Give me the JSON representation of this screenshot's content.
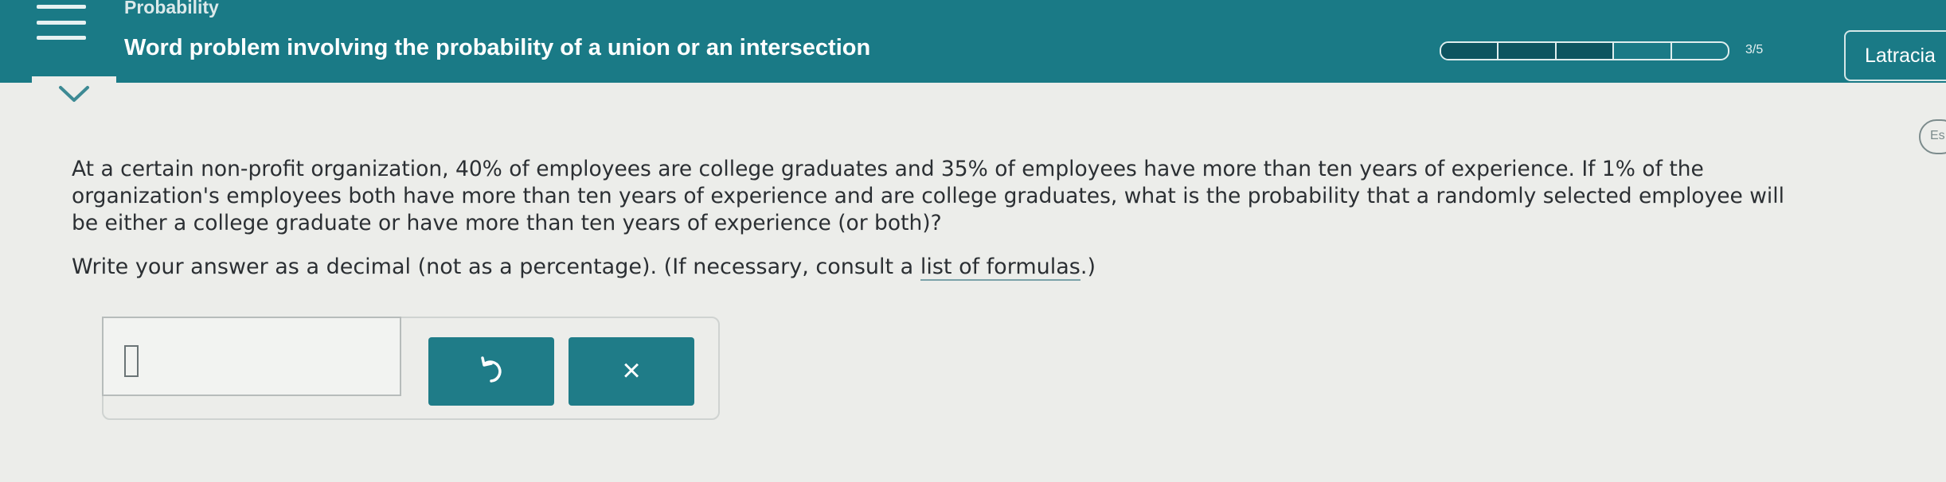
{
  "header": {
    "topic": "Probability",
    "title": "Word problem involving the probability of a union or an intersection",
    "progress_text": "3/5",
    "progress": {
      "completed": 3,
      "total": 5
    },
    "user_name": "Latracia",
    "bg_color": "#1a7a86"
  },
  "side_tab": {
    "label": "Es"
  },
  "problem": {
    "line1": "At a certain non-profit organization, 40% of employees are college graduates and 35% of employees have more than ten years of experience. If 1% of the",
    "line2": "organization's employees both have more than ten years of experience and are college graduates, what is the probability that a randomly selected employee will",
    "line3": "be either a college graduate or have more than ten years of experience (or both)?"
  },
  "instruction": {
    "before": "Write your answer as a decimal (not as a percentage). (If necessary, consult a ",
    "link": "list of formulas",
    "after": ".)"
  },
  "answer": {
    "value": "",
    "clear_label": "×",
    "button_color": "#1f7c88"
  },
  "icons": {
    "menu": "hamburger-menu-icon",
    "expand": "chevron-down-icon",
    "undo": "undo-icon"
  }
}
